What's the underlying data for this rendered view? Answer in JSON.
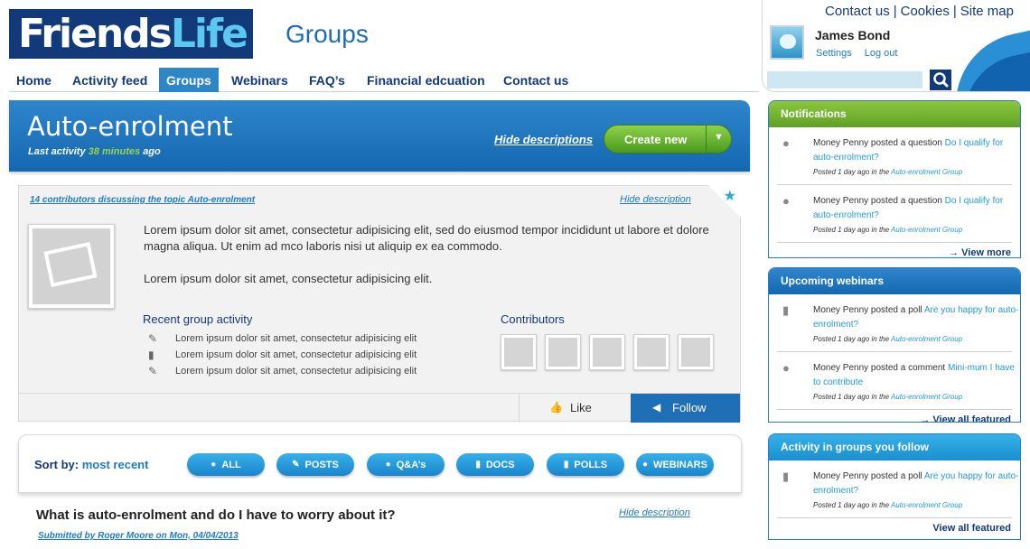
{
  "header": {
    "logo_friends": "Friends",
    "logo_life": "Life",
    "section_title": "Groups",
    "top_links": [
      "Contact us",
      "Cookies",
      "Site map"
    ],
    "user_name": "James Bond",
    "settings_label": "Settings",
    "logout_label": "Log out",
    "search_placeholder": ""
  },
  "nav": {
    "items": [
      "Home",
      "Activity feed",
      "Groups",
      "Webinars",
      "FAQ’s",
      "Financial edcuation",
      "Contact us"
    ],
    "active": "Groups"
  },
  "banner": {
    "title": "Auto-enrolment",
    "last_activity_prefix": "Last activity",
    "last_activity_value": "38 minutes",
    "last_activity_suffix": "ago",
    "hide_descriptions": "Hide descriptions",
    "create_new": "Create new"
  },
  "description_card": {
    "contributors_link": "14 contributors discussing the topic Auto-enrolment",
    "hide_description": "Hide description",
    "paragraph1": "Lorem ipsum dolor sit amet, consectetur adipisicing elit, sed do eiusmod tempor incididunt ut labore et dolore magna aliqua. Ut enim ad mco laboris nisi ut aliquip ex ea commodo.",
    "paragraph2": "Lorem ipsum dolor sit amet, consectetur adipisicing elit.",
    "recent_title": "Recent group activity",
    "recent_items": [
      {
        "icon": "pencil-icon",
        "text": "Lorem ipsum dolor sit amet, consectetur adipisicing elit"
      },
      {
        "icon": "document-icon",
        "text": "Lorem ipsum dolor sit amet, consectetur adipisicing elit"
      },
      {
        "icon": "pencil-icon",
        "text": "Lorem ipsum dolor sit amet, consectetur adipisicing elit"
      }
    ],
    "contributors_title": "Contributors",
    "like_label": "Like",
    "follow_label": "Follow"
  },
  "sort": {
    "label": "Sort by:",
    "value": "most recent",
    "filters": [
      "ALL",
      "POSTS",
      "Q&A’s",
      "DOCS",
      "POLLS",
      "WEBINARS"
    ]
  },
  "post": {
    "title": "What is auto-enrolment and do I have to worry about it?",
    "meta": "Submitted by Roger Moore on Mon, 04/04/2013",
    "hide_description": "Hide description"
  },
  "notifications": {
    "title": "Notifications",
    "items": [
      {
        "text": "Money Penny posted a question",
        "link": "Do I qualify for auto-enrolment?",
        "meta": "Posted 1 day ago in the",
        "group": "Auto-enrolment Group"
      },
      {
        "text": "Money Penny posted a question",
        "link": "Do I qualify for auto-enrolment?",
        "meta": "Posted 1 day ago in the",
        "group": "Auto-enrolment Group"
      }
    ],
    "footer": "→ View more"
  },
  "webinars": {
    "title": "Upcoming webinars",
    "items": [
      {
        "text": "Money Penny posted a poll",
        "link": "Are you happy for auto-enrolment?",
        "meta": "Posted 1 day ago in the",
        "group": "Auto-enrolment Group"
      },
      {
        "text": "Money Penny posted a comment",
        "link": "Mini-mum I have to contribute",
        "meta": "Posted 1 day ago in the",
        "group": "Auto-enrolment Group"
      }
    ],
    "footer": "→ View all featured"
  },
  "activity": {
    "title": "Activity in groups you follow",
    "items": [
      {
        "text": "Money Penny posted a poll",
        "link": "Are you happy for auto-enrolment?",
        "meta": "Posted 1 day ago in the",
        "group": "Auto-enrolment Group"
      }
    ],
    "footer": "View all featured"
  },
  "colors": {
    "brand_navy": "#12397a",
    "brand_blue": "#1f6fb7",
    "accent_green": "#7cbf3a",
    "link_blue": "#1f9bd4"
  }
}
